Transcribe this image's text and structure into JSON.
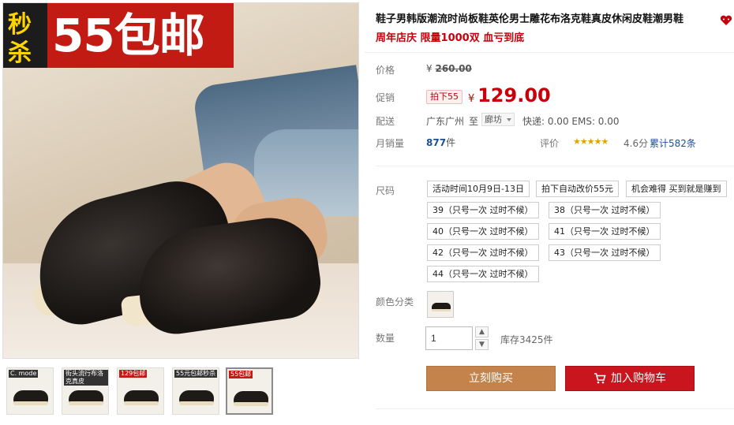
{
  "banner": {
    "left_top": "秒",
    "left_bottom": "杀",
    "main": "55包邮"
  },
  "thumbnails": [
    {
      "label": "C. mode"
    },
    {
      "label": "街头流行布洛克真皮"
    },
    {
      "label": "129包邮"
    },
    {
      "label": "55元包邮秒杀"
    },
    {
      "label": "55包邮"
    }
  ],
  "product": {
    "title": "鞋子男韩版潮流时尚板鞋英伦男士雕花布洛克鞋真皮休闲皮鞋潮男鞋",
    "subtitle": "周年店庆 限量1000双 血亏到底"
  },
  "price": {
    "label": "价格",
    "currency": "¥",
    "original": "260.00",
    "promo_label": "促销",
    "promo_tag": "拍下55",
    "promo_price": "129.00"
  },
  "shipping": {
    "label": "配送",
    "from": "广东广州",
    "to_word": "至",
    "city": "廊坊",
    "fees": "快递: 0.00 EMS: 0.00"
  },
  "sales": {
    "label": "月销量",
    "count": "877",
    "unit": "件",
    "rating_label": "评价",
    "stars": "★★★★★",
    "score": "4.6分",
    "total": "累计582条"
  },
  "sizes": {
    "label": "尺码",
    "options": [
      "活动时间10月9日-13日",
      "拍下自动改价55元",
      "机会难得 买到就是赚到",
      "39（只号一次 过时不候）",
      "38（只号一次 过时不候）",
      "40（只号一次 过时不候）",
      "41（只号一次 过时不候）",
      "42（只号一次 过时不候）",
      "43（只号一次 过时不候）",
      "44（只号一次 过时不候）"
    ]
  },
  "color": {
    "label": "颜色分类"
  },
  "quantity": {
    "label": "数量",
    "value": "1",
    "stock": "库存3425件",
    "up": "▲",
    "down": "▼"
  },
  "actions": {
    "buy_now": "立刻购买",
    "add_cart": "加入购物车"
  },
  "colors": {
    "accent_red": "#c8000a",
    "buy_brown": "#c4834a",
    "cart_red": "#c8151e"
  }
}
